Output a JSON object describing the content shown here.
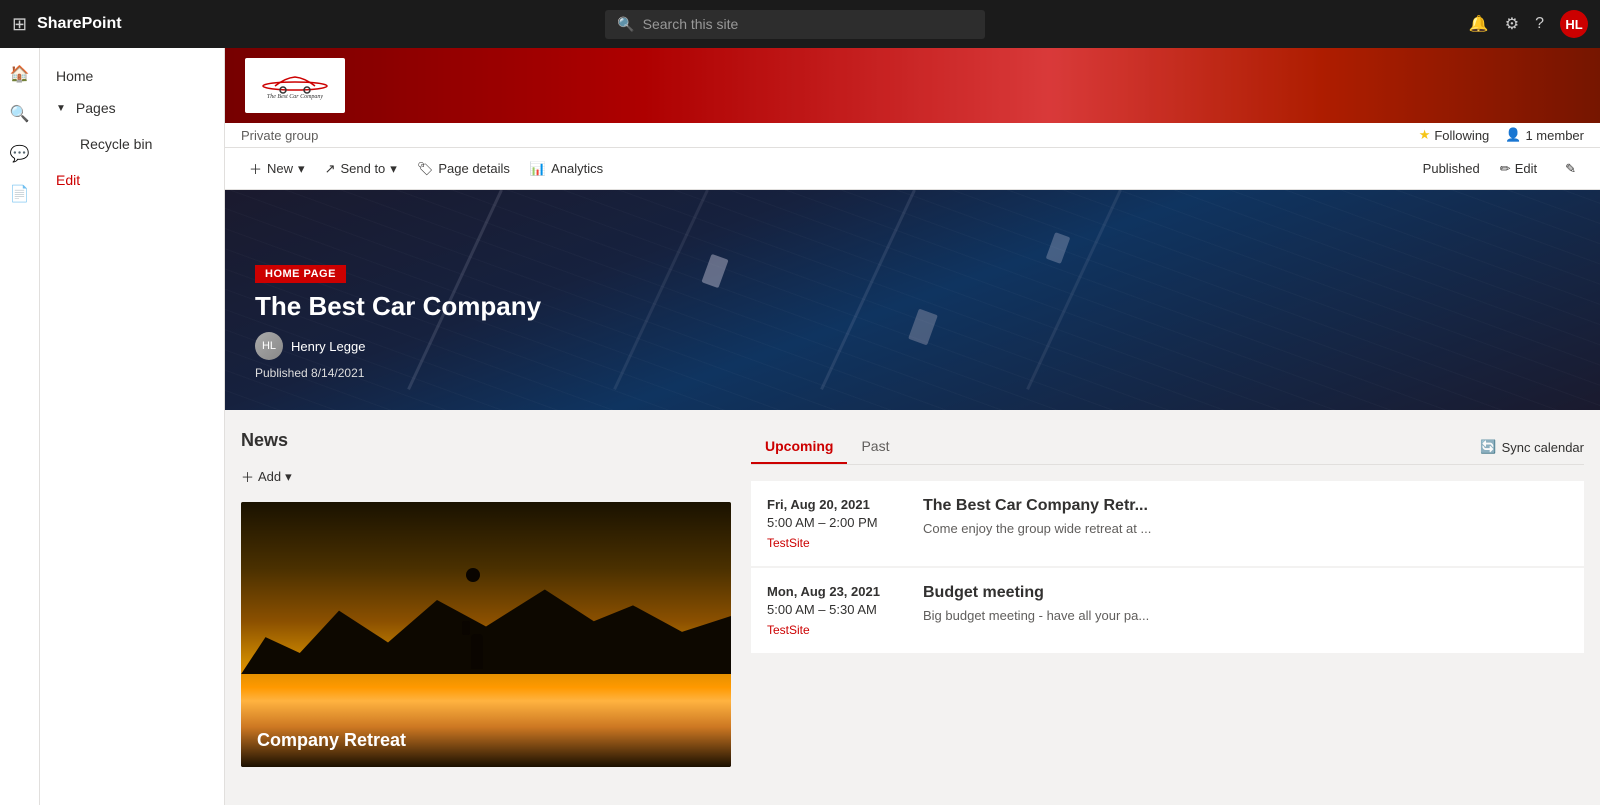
{
  "app": {
    "title": "SharePoint",
    "search_placeholder": "Search this site"
  },
  "topnav": {
    "brand": "SharePoint",
    "search_placeholder": "Search this site",
    "user_initials": "HL"
  },
  "site": {
    "private_group_label": "Private group",
    "following_label": "Following",
    "members_label": "1 member"
  },
  "action_bar": {
    "new_label": "New",
    "send_to_label": "Send to",
    "page_details_label": "Page details",
    "analytics_label": "Analytics",
    "published_label": "Published",
    "edit_label": "Edit"
  },
  "nav": {
    "home": "Home",
    "pages": "Pages",
    "recycle_bin": "Recycle bin",
    "edit": "Edit"
  },
  "hero": {
    "badge": "HOME PAGE",
    "title": "The Best Car Company",
    "author": "Henry Legge",
    "published": "Published 8/14/2021"
  },
  "news": {
    "title": "News",
    "add_label": "Add",
    "card_title": "Company Retreat"
  },
  "events": {
    "tab_upcoming": "Upcoming",
    "tab_past": "Past",
    "sync_label": "Sync calendar",
    "items": [
      {
        "date": "Fri, Aug 20, 2021",
        "time": "5:00 AM – 2:00 PM",
        "site": "TestSite",
        "title": "The Best Car Company Retr...",
        "desc": "Come enjoy the group wide retreat at ..."
      },
      {
        "date": "Mon, Aug 23, 2021",
        "time": "5:00 AM – 5:30 AM",
        "site": "TestSite",
        "title": "Budget meeting",
        "desc": "Big budget meeting - have all your pa..."
      }
    ]
  },
  "sidebar": {
    "icons": [
      "⊞",
      "🏠",
      "🔍",
      "💬",
      "📄"
    ],
    "home_icon": "⌂",
    "search_icon": "⊕",
    "chat_icon": "💬",
    "pages_icon": "📄"
  },
  "colors": {
    "accent": "#c00000",
    "star": "#f5c518"
  }
}
